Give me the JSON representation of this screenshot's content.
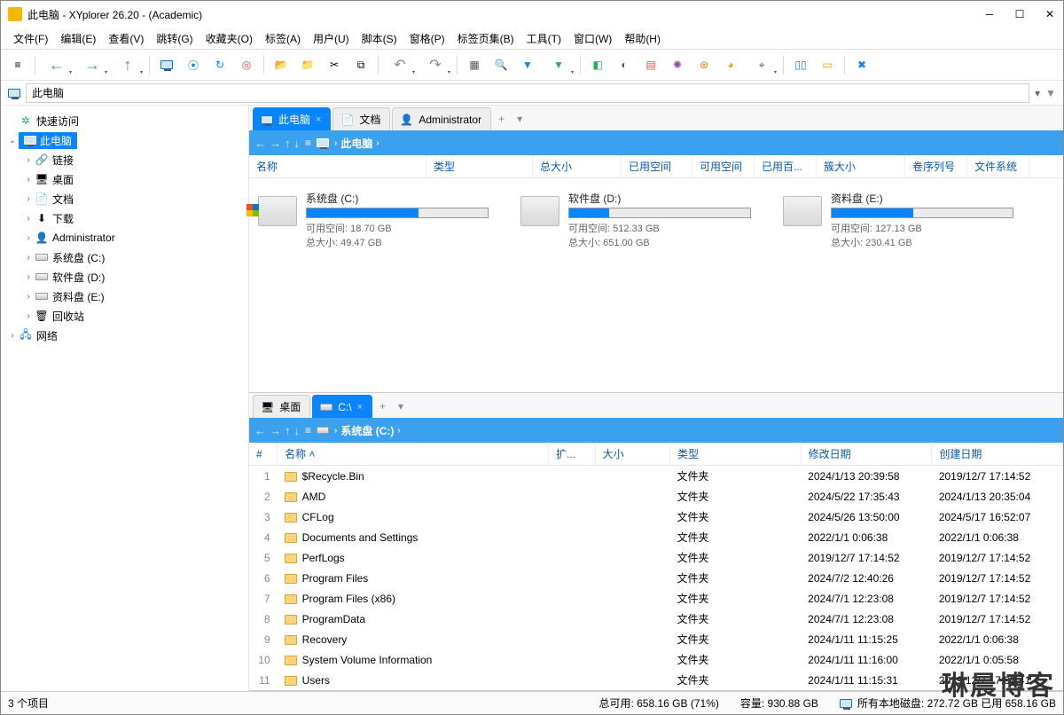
{
  "window": {
    "title": "此电脑 - XYplorer 26.20 - (Academic)"
  },
  "menus": [
    "文件(F)",
    "编辑(E)",
    "查看(V)",
    "跳转(G)",
    "收藏夹(O)",
    "标签(A)",
    "用户(U)",
    "脚本(S)",
    "窗格(P)",
    "标签页集(B)",
    "工具(T)",
    "窗口(W)",
    "帮助(H)"
  ],
  "address": {
    "text": "此电脑"
  },
  "tree": {
    "quick": "快速访问",
    "thispc": "此电脑",
    "items": [
      "链接",
      "桌面",
      "文档",
      "下载",
      "Administrator",
      "系统盘 (C:)",
      "软件盘 (D:)",
      "资料盘 (E:)",
      "回收站"
    ],
    "network": "网络"
  },
  "topPane": {
    "tabs": [
      {
        "label": "此电脑",
        "active": true
      },
      {
        "label": "文档",
        "active": false
      },
      {
        "label": "Administrator",
        "active": false
      }
    ],
    "crumb": "此电脑",
    "columns": [
      "名称",
      "类型",
      "总大小",
      "已用空间",
      "可用空间",
      "已用百...",
      "簇大小",
      "卷序列号",
      "文件系统"
    ],
    "drives": [
      {
        "name": "系统盘 (C:)",
        "free": "可用空间: 18.70 GB",
        "total": "总大小: 49.47 GB",
        "pct": 62,
        "win": true
      },
      {
        "name": "软件盘 (D:)",
        "free": "可用空间: 512.33 GB",
        "total": "总大小: 651.00 GB",
        "pct": 22,
        "win": false
      },
      {
        "name": "资料盘 (E:)",
        "free": "可用空间: 127.13 GB",
        "total": "总大小: 230.41 GB",
        "pct": 45,
        "win": false
      }
    ]
  },
  "botPane": {
    "tabs": [
      {
        "label": "桌面",
        "active": false
      },
      {
        "label": "C:\\",
        "active": true
      }
    ],
    "crumb": "系统盘 (C:)",
    "headers": [
      "#",
      "名称",
      "扩...",
      "大小",
      "类型",
      "修改日期",
      "创建日期"
    ],
    "rows": [
      {
        "n": 1,
        "name": "$Recycle.Bin",
        "type": "文件夹",
        "mod": "2024/1/13 20:39:58",
        "cre": "2019/12/7 17:14:52"
      },
      {
        "n": 2,
        "name": "AMD",
        "type": "文件夹",
        "mod": "2024/5/22 17:35:43",
        "cre": "2024/1/13 20:35:04"
      },
      {
        "n": 3,
        "name": "CFLog",
        "type": "文件夹",
        "mod": "2024/5/26 13:50:00",
        "cre": "2024/5/17 16:52:07"
      },
      {
        "n": 4,
        "name": "Documents and Settings",
        "type": "文件夹",
        "mod": "2022/1/1 0:06:38",
        "cre": "2022/1/1 0:06:38"
      },
      {
        "n": 5,
        "name": "PerfLogs",
        "type": "文件夹",
        "mod": "2019/12/7 17:14:52",
        "cre": "2019/12/7 17:14:52"
      },
      {
        "n": 6,
        "name": "Program Files",
        "type": "文件夹",
        "mod": "2024/7/2 12:40:26",
        "cre": "2019/12/7 17:14:52"
      },
      {
        "n": 7,
        "name": "Program Files (x86)",
        "type": "文件夹",
        "mod": "2024/7/1 12:23:08",
        "cre": "2019/12/7 17:14:52"
      },
      {
        "n": 8,
        "name": "ProgramData",
        "type": "文件夹",
        "mod": "2024/7/1 12:23:08",
        "cre": "2019/12/7 17:14:52"
      },
      {
        "n": 9,
        "name": "Recovery",
        "type": "文件夹",
        "mod": "2024/1/11 11:15:25",
        "cre": "2022/1/1 0:06:38"
      },
      {
        "n": 10,
        "name": "System Volume Information",
        "type": "文件夹",
        "mod": "2024/1/11 11:16:00",
        "cre": "2022/1/1 0:05:58"
      },
      {
        "n": 11,
        "name": "Users",
        "type": "文件夹",
        "mod": "2024/1/11 11:15:31",
        "cre": "2019/12/7 17:03:41"
      }
    ]
  },
  "status": {
    "items": "3 个项目",
    "free": "总可用: 658.16 GB (71%)",
    "cap": "容量: 930.88 GB",
    "disks": "所有本地磁盘: 272.72 GB 已用 658.16 GB"
  },
  "watermark": "琳晨博客"
}
